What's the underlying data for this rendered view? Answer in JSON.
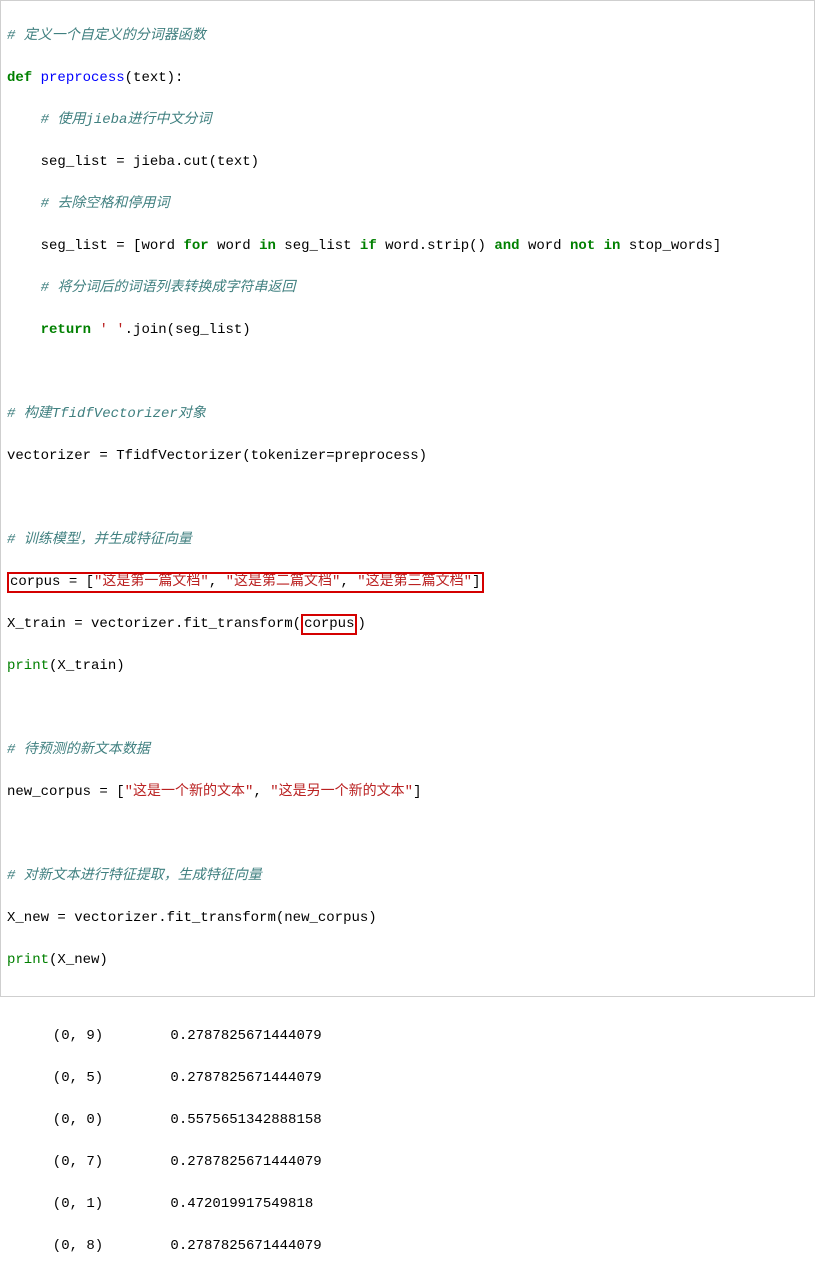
{
  "code": {
    "l0": "# 定义一个自定义的分词器函数",
    "l1_def": "def",
    "l1_fn": "preprocess",
    "l1_rest": "(text):",
    "l2": "# 使用jieba进行中文分词",
    "l3_a": "seg_list ",
    "l3_op": "=",
    "l3_b": " jieba.cut(text)",
    "l4": "# 去除空格和停用词",
    "l5_a": "seg_list ",
    "l5_op": "=",
    "l5_b": " [word ",
    "l5_for": "for",
    "l5_c": " word ",
    "l5_in": "in",
    "l5_d": " seg_list ",
    "l5_if": "if",
    "l5_e": " word.strip() ",
    "l5_and": "and",
    "l5_f": " word ",
    "l5_not": "not",
    "l5_g": " ",
    "l5_in2": "in",
    "l5_h": " stop_words]",
    "l6": "# 将分词后的词语列表转换成字符串返回",
    "l7_ret": "return",
    "l7_sp": " ",
    "l7_str": "' '",
    "l7_rest": ".join(seg_list)",
    "l8": "# 构建TfidfVectorizer对象",
    "l9_a": "vectorizer ",
    "l9_op": "=",
    "l9_b": " TfidfVectorizer(tokenizer",
    "l9_op2": "=",
    "l9_c": "preprocess)",
    "l10": "# 训练模型，并生成特征向量",
    "l11_a": "corpus ",
    "l11_op": "=",
    "l11_b": " [",
    "l11_s1": "\"这是第一篇文档\"",
    "l11_c": ", ",
    "l11_s2": "\"这是第二篇文档\"",
    "l11_d": ", ",
    "l11_s3": "\"这是第三篇文档\"",
    "l11_e": "]",
    "l12_a": "X_train ",
    "l12_op": "=",
    "l12_b": " vectorizer.fit_transform(",
    "l12_arg": "corpus",
    "l12_c": ")",
    "l13_p": "print",
    "l13_r": "(X_train)",
    "l14": "# 待预测的新文本数据",
    "l15_a": "new_corpus ",
    "l15_op": "=",
    "l15_b": " [",
    "l15_s1": "\"这是一个新的文本\"",
    "l15_c": ", ",
    "l15_s2": "\"这是另一个新的文本\"",
    "l15_d": "]",
    "l16": "# 对新文本进行特征提取，生成特征向量",
    "l17_a": "X_new ",
    "l17_op": "=",
    "l17_b": " vectorizer.fit_transform(new_corpus)",
    "l18_p": "print",
    "l18_r": "(X_new)"
  },
  "output": {
    "r0": "  (0, 9)\t0.2787825671444079",
    "r1": "  (0, 5)\t0.2787825671444079",
    "r2": "  (0, 0)\t0.5575651342888158",
    "r3": "  (0, 7)\t0.2787825671444079",
    "r4": "  (0, 1)\t0.472019917549818",
    "r5": "  (0, 8)\t0.2787825671444079"
  }
}
